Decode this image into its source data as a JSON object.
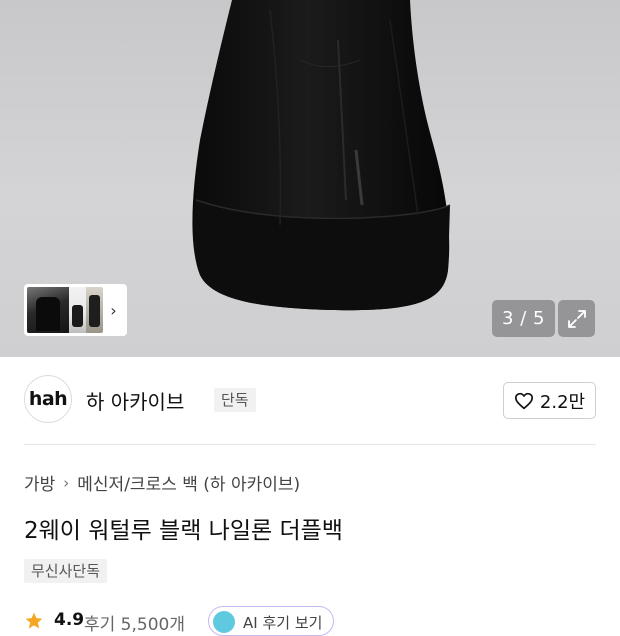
{
  "gallery": {
    "current": "3",
    "total": "5",
    "counter_text": "3 / 5",
    "thumbnail_arrow": "›"
  },
  "brand": {
    "logo_text": "hah",
    "name": "하 아카이브",
    "exclusive_badge": "단독",
    "like_count": "2.2만"
  },
  "breadcrumb": {
    "category": "가방",
    "subcategory": "메신저/크로스 백 (하 아카이브)"
  },
  "product": {
    "title": "2웨이 워털루 블랙 나일론 더플백",
    "tag": "무신사단독"
  },
  "rating": {
    "value": "4.9",
    "reviews": "후기 5,500개",
    "review_summary_label": "AI 후기 보기"
  },
  "colors": {
    "star": "#f5a623",
    "pill_border": "#c7b8f0"
  }
}
